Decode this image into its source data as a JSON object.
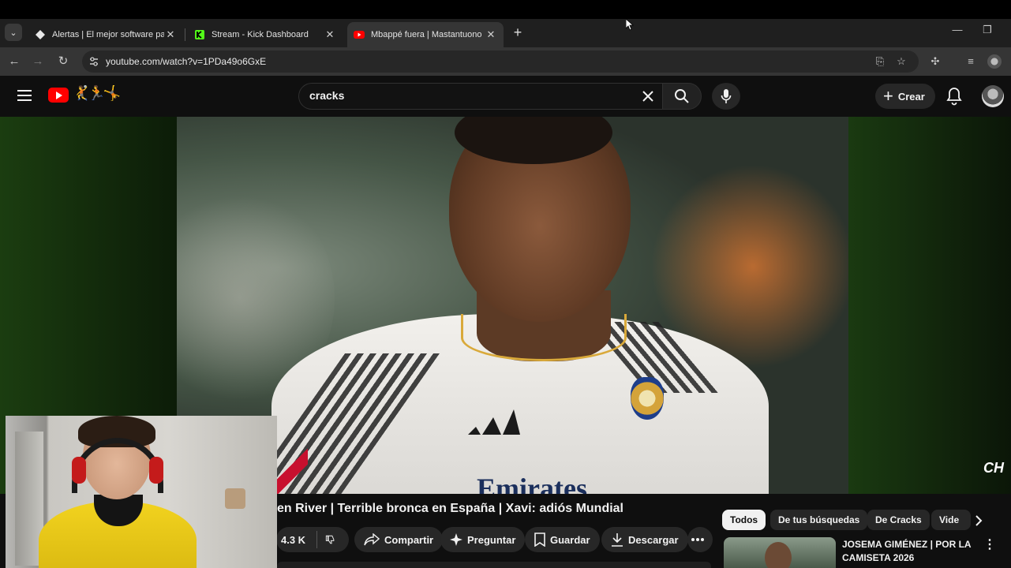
{
  "browser": {
    "tabs": [
      {
        "title": "Alertas | El mejor software para",
        "icon": "alertas-favicon",
        "active": false
      },
      {
        "title": "Stream - Kick Dashboard",
        "icon": "kick-favicon",
        "active": false
      },
      {
        "title": "Mbappé fuera | Mastantuono b",
        "icon": "youtube-favicon",
        "active": true
      }
    ],
    "url": "youtube.com/watch?v=1PDa49o6GxE"
  },
  "youtube": {
    "search_value": "cracks",
    "create_label": "Crear",
    "doodle": "🤾🏃🤸"
  },
  "video": {
    "watermark": "CH",
    "jersey_sponsor": "Emirates",
    "title": "en River | Terrible bronca en España | Xavi: adiós Mundial",
    "likes": "4.3 K",
    "share_label": "Compartir",
    "ask_label": "Preguntar",
    "save_label": "Guardar",
    "download_label": "Descargar"
  },
  "chips": [
    "Todos",
    "De tus búsquedas",
    "De Cracks",
    "Vide"
  ],
  "recommendation": {
    "title": "JOSEMA GIMÉNEZ | POR LA CAMISETA 2026"
  },
  "colors": {
    "youtube_red": "#ff0000",
    "background": "#0f0f0f",
    "chip_bg": "#272727"
  }
}
